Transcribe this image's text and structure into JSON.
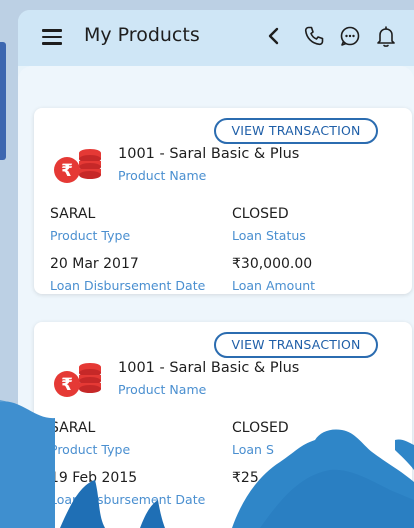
{
  "header": {
    "title": "My Products"
  },
  "products": [
    {
      "view_button": "VIEW TRANSACTION",
      "product_name": "1001 - Saral Basic & Plus",
      "product_name_label": "Product Name",
      "product_type": "SARAL",
      "product_type_label": "Product Type",
      "loan_status": "CLOSED",
      "loan_status_label": "Loan Status",
      "disbursement_date": "20 Mar 2017",
      "disbursement_date_label": "Loan Disbursement Date",
      "loan_amount": "₹30,000.00",
      "loan_amount_label": "Loan Amount"
    },
    {
      "view_button": "VIEW TRANSACTION",
      "product_name": "1001 - Saral Basic & Plus",
      "product_name_label": "Product Name",
      "product_type": "SARAL",
      "product_type_label": "Product Type",
      "loan_status": "CLOSED",
      "loan_status_label": "Loan S",
      "disbursement_date": "19 Feb 2015",
      "disbursement_date_label": "Loan Disbursement Date",
      "loan_amount": "₹25"
    }
  ],
  "colors": {
    "accent": "#2b6cb0",
    "label": "#4a8fd0",
    "coin": "#e53935",
    "wave": "#2f86c8"
  }
}
